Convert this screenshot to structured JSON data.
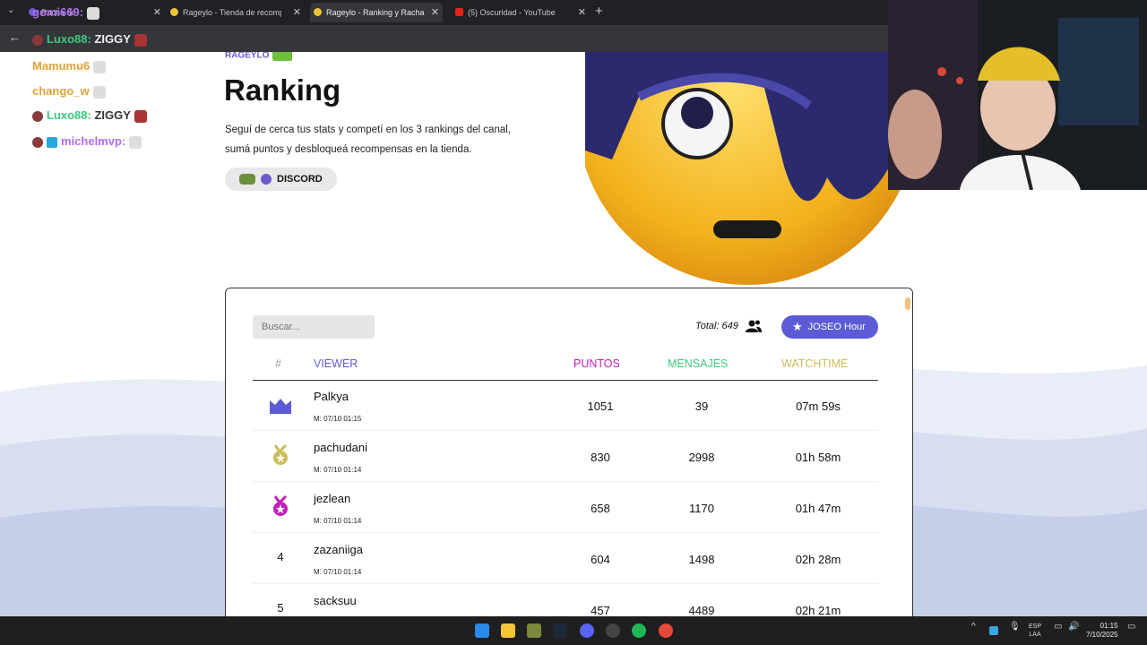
{
  "browser": {
    "tabs": [
      {
        "label": "Racha de",
        "active": false
      },
      {
        "label": "Rageylo - Tienda de recompen",
        "active": false
      },
      {
        "label": "Rageylo - Ranking y Racha de",
        "active": true
      },
      {
        "label": "(5) Oscuridad - YouTube",
        "active": false
      }
    ],
    "new_tab": "+",
    "close_glyph": "✕",
    "back_glyph": "←",
    "tab_menu_glyph": "⌄"
  },
  "page": {
    "brand": "RAGEYLO",
    "title": "Ranking",
    "description": "Seguí de cerca tus stats y competí en los 3 rankings del canal, sumá puntos y desbloqueá recompensas en la tienda.",
    "discord_label": "DISCORD"
  },
  "table": {
    "search_placeholder": "Buscar...",
    "total_label": "Total: 649",
    "joseo_label": "JOSEO Hour",
    "headers": {
      "num": "#",
      "viewer": "VIEWER",
      "points": "PUNTOS",
      "messages": "MENSAJES",
      "watchtime": "WATCHTIME"
    },
    "rows": [
      {
        "rank": "",
        "badge": "crown",
        "name": "Palkya",
        "date": "M: 07/10 01:15",
        "points": "1051",
        "messages": "39",
        "watchtime": "07m 59s"
      },
      {
        "rank": "",
        "badge": "medal-gold",
        "name": "pachudani",
        "date": "M: 07/10 01:14",
        "points": "830",
        "messages": "2998",
        "watchtime": "01h 58m"
      },
      {
        "rank": "",
        "badge": "medal-pink",
        "name": "jezlean",
        "date": "M: 07/10 01:14",
        "points": "658",
        "messages": "1170",
        "watchtime": "01h 47m"
      },
      {
        "rank": "4",
        "badge": "",
        "name": "zazaniiga",
        "date": "M: 07/10 01:14",
        "points": "604",
        "messages": "1498",
        "watchtime": "02h 28m"
      },
      {
        "rank": "5",
        "badge": "",
        "name": "sacksuu",
        "date": "",
        "points": "457",
        "messages": "4489",
        "watchtime": "02h 21m"
      }
    ]
  },
  "chat_overlay": [
    {
      "user": "gomi669:",
      "color": "#b06cf0",
      "text": ""
    },
    {
      "user": "Luxo88:",
      "color": "#3cc97a",
      "text": "ZIGGY"
    },
    {
      "user": "Mamumu6",
      "color": "#e0a23a",
      "text": ""
    },
    {
      "user": "chango_w",
      "color": "#e0a23a",
      "text": ""
    },
    {
      "user": "Luxo88:",
      "color": "#3cc97a",
      "text": "ZIGGY"
    },
    {
      "user": "michelmvp:",
      "color": "#b06cf0",
      "text": ""
    }
  ],
  "taskbar": {
    "language": "ESP",
    "layout": "LAA",
    "time": "01:15",
    "date": "7/10/2025"
  },
  "colors": {
    "accent": "#5b5bd6",
    "points": "#c41fb8",
    "messages": "#3cc97a",
    "watchtime": "#cdbd5a"
  }
}
